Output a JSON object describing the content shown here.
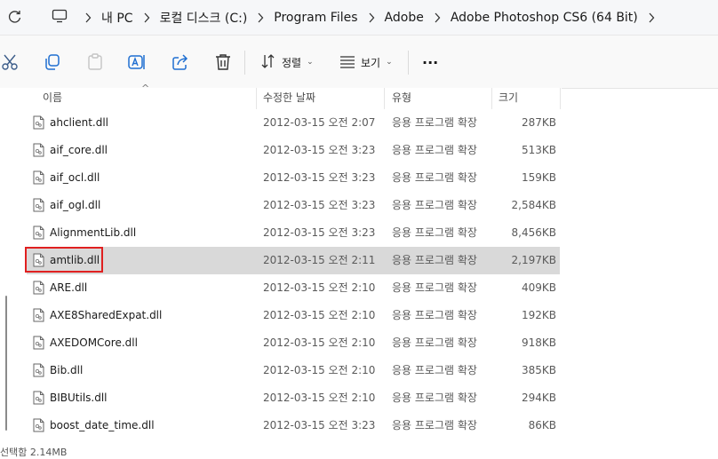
{
  "breadcrumb": [
    "내 PC",
    "로컬 디스크 (C:)",
    "Program Files",
    "Adobe",
    "Adobe Photoshop CS6 (64 Bit)"
  ],
  "toolbar": {
    "sort_label": "정렬",
    "view_label": "보기",
    "more_label": "···",
    "icons": [
      "cut-icon",
      "copy-icon",
      "paste-icon",
      "rename-icon",
      "share-icon",
      "delete-icon"
    ]
  },
  "columns": {
    "name": "이름",
    "modified": "수정한 날짜",
    "type": "유형",
    "size": "크기"
  },
  "files": [
    {
      "name": "ahclient.dll",
      "modified": "2012-03-15 오전 2:07",
      "type": "응용 프로그램 확장",
      "size": "287KB"
    },
    {
      "name": "aif_core.dll",
      "modified": "2012-03-15 오전 3:23",
      "type": "응용 프로그램 확장",
      "size": "513KB"
    },
    {
      "name": "aif_ocl.dll",
      "modified": "2012-03-15 오전 3:23",
      "type": "응용 프로그램 확장",
      "size": "159KB"
    },
    {
      "name": "aif_ogl.dll",
      "modified": "2012-03-15 오전 3:23",
      "type": "응용 프로그램 확장",
      "size": "2,584KB"
    },
    {
      "name": "AlignmentLib.dll",
      "modified": "2012-03-15 오전 3:23",
      "type": "응용 프로그램 확장",
      "size": "8,456KB"
    },
    {
      "name": "amtlib.dll",
      "modified": "2012-03-15 오전 2:11",
      "type": "응용 프로그램 확장",
      "size": "2,197KB",
      "selected": true
    },
    {
      "name": "ARE.dll",
      "modified": "2012-03-15 오전 2:10",
      "type": "응용 프로그램 확장",
      "size": "409KB"
    },
    {
      "name": "AXE8SharedExpat.dll",
      "modified": "2012-03-15 오전 2:10",
      "type": "응용 프로그램 확장",
      "size": "192KB"
    },
    {
      "name": "AXEDOMCore.dll",
      "modified": "2012-03-15 오전 2:10",
      "type": "응용 프로그램 확장",
      "size": "918KB"
    },
    {
      "name": "Bib.dll",
      "modified": "2012-03-15 오전 2:10",
      "type": "응용 프로그램 확장",
      "size": "385KB"
    },
    {
      "name": "BIBUtils.dll",
      "modified": "2012-03-15 오전 2:10",
      "type": "응용 프로그램 확장",
      "size": "294KB"
    },
    {
      "name": "boost_date_time.dll",
      "modified": "2012-03-15 오전 3:23",
      "type": "응용 프로그램 확장",
      "size": "86KB"
    }
  ],
  "status": {
    "text": "선택함 2.14MB"
  },
  "colors": {
    "selected_row": "#d9d9d9",
    "highlight_border": "#e02020"
  }
}
